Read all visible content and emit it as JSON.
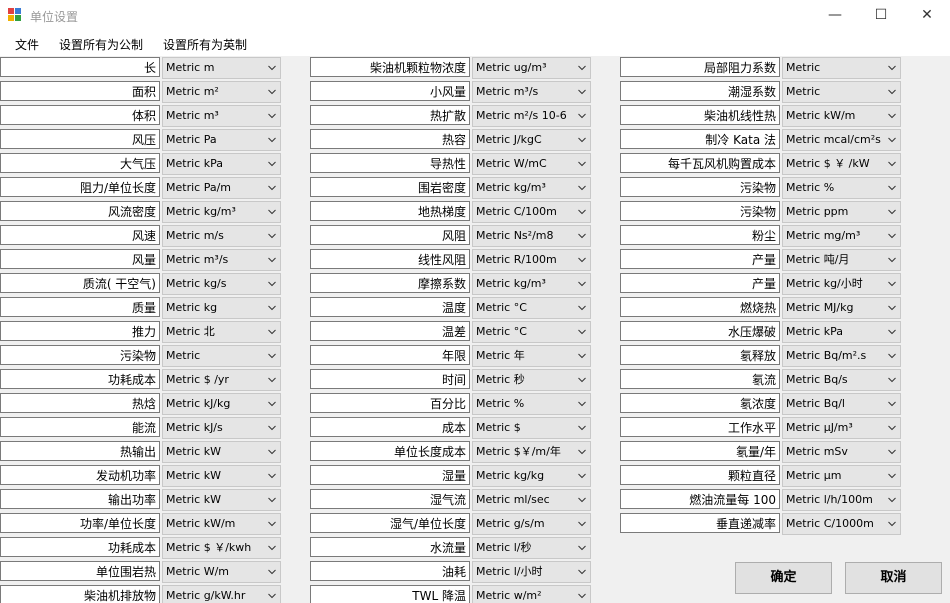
{
  "window": {
    "title": "单位设置"
  },
  "menu": {
    "file": "文件",
    "set_metric": "设置所有为公制",
    "set_imperial": "设置所有为英制"
  },
  "columns": [
    {
      "rows": [
        {
          "label": "长",
          "unit": "Metric m"
        },
        {
          "label": "面积",
          "unit": "Metric m²"
        },
        {
          "label": "体积",
          "unit": "Metric m³"
        },
        {
          "label": "风压",
          "unit": "Metric Pa"
        },
        {
          "label": "大气压",
          "unit": "Metric kPa"
        },
        {
          "label": "阻力/单位长度",
          "unit": "Metric Pa/m"
        },
        {
          "label": "风流密度",
          "unit": "Metric kg/m³"
        },
        {
          "label": "风速",
          "unit": "Metric m/s"
        },
        {
          "label": "风量",
          "unit": "Metric m³/s"
        },
        {
          "label": "质流( 干空气)",
          "unit": "Metric kg/s"
        },
        {
          "label": "质量",
          "unit": "Metric kg"
        },
        {
          "label": "推力",
          "unit": "Metric 北"
        },
        {
          "label": "污染物",
          "unit": "Metric"
        },
        {
          "label": "功耗成本",
          "unit": "Metric $ /yr"
        },
        {
          "label": "热焓",
          "unit": "Metric kJ/kg"
        },
        {
          "label": "能流",
          "unit": "Metric kJ/s"
        },
        {
          "label": "热输出",
          "unit": "Metric kW"
        },
        {
          "label": "发动机功率",
          "unit": "Metric kW"
        },
        {
          "label": "输出功率",
          "unit": "Metric kW"
        },
        {
          "label": "功率/单位长度",
          "unit": "Metric kW/m"
        },
        {
          "label": "功耗成本",
          "unit": "Metric $ ￥/kwh"
        },
        {
          "label": "单位围岩热",
          "unit": "Metric W/m"
        },
        {
          "label": "柴油机排放物",
          "unit": "Metric g/kW.hr"
        }
      ]
    },
    {
      "rows": [
        {
          "label": "柴油机颗粒物浓度",
          "unit": "Metric ug/m³"
        },
        {
          "label": "小风量",
          "unit": "Metric m³/s"
        },
        {
          "label": "热扩散",
          "unit": "Metric m²/s 10-6"
        },
        {
          "label": "热容",
          "unit": "Metric J/kgC"
        },
        {
          "label": "导热性",
          "unit": "Metric W/mC"
        },
        {
          "label": "围岩密度",
          "unit": "Metric kg/m³"
        },
        {
          "label": "地热梯度",
          "unit": "Metric C/100m"
        },
        {
          "label": "风阻",
          "unit": "Metric Ns²/m8"
        },
        {
          "label": "线性风阻",
          "unit": "Metric R/100m"
        },
        {
          "label": "摩擦系数",
          "unit": "Metric kg/m³"
        },
        {
          "label": "温度",
          "unit": "Metric °C"
        },
        {
          "label": "温差",
          "unit": "Metric °C"
        },
        {
          "label": "年限",
          "unit": "Metric 年"
        },
        {
          "label": "时间",
          "unit": "Metric 秒"
        },
        {
          "label": "百分比",
          "unit": "Metric %"
        },
        {
          "label": "成本",
          "unit": "Metric $"
        },
        {
          "label": "单位长度成本",
          "unit": "Metric $￥/m/年"
        },
        {
          "label": "湿量",
          "unit": "Metric kg/kg"
        },
        {
          "label": "湿气流",
          "unit": "Metric ml/sec"
        },
        {
          "label": "湿气/单位长度",
          "unit": "Metric g/s/m"
        },
        {
          "label": "水流量",
          "unit": "Metric l/秒"
        },
        {
          "label": "油耗",
          "unit": "Metric l/小时"
        },
        {
          "label": "TWL 降温",
          "unit": "Metric w/m²"
        }
      ]
    },
    {
      "rows": [
        {
          "label": "局部阻力系数",
          "unit": "Metric"
        },
        {
          "label": "潮湿系数",
          "unit": "Metric"
        },
        {
          "label": "柴油机线性热",
          "unit": "Metric kW/m"
        },
        {
          "label": "制冷 Kata 法",
          "unit": "Metric mcal/cm²s"
        },
        {
          "label": "每千瓦风机购置成本",
          "unit": "Metric $ ￥ /kW"
        },
        {
          "label": "污染物",
          "unit": "Metric %"
        },
        {
          "label": "污染物",
          "unit": "Metric ppm"
        },
        {
          "label": "粉尘",
          "unit": "Metric mg/m³"
        },
        {
          "label": "产量",
          "unit": "Metric 吨/月"
        },
        {
          "label": "产量",
          "unit": "Metric kg/小时"
        },
        {
          "label": "燃烧热",
          "unit": "Metric MJ/kg"
        },
        {
          "label": "水压爆破",
          "unit": "Metric kPa"
        },
        {
          "label": "氡释放",
          "unit": "Metric Bq/m².s"
        },
        {
          "label": "氡流",
          "unit": "Metric Bq/s"
        },
        {
          "label": "氡浓度",
          "unit": "Metric Bq/l"
        },
        {
          "label": "工作水平",
          "unit": "Metric μJ/m³"
        },
        {
          "label": "氡量/年",
          "unit": "Metric mSv"
        },
        {
          "label": "颗粒直径",
          "unit": "Metric μm"
        },
        {
          "label": "燃油流量每   100",
          "unit": "Metric l/h/100m"
        },
        {
          "label": "垂直递减率",
          "unit": "Metric C/1000m"
        }
      ]
    }
  ],
  "buttons": {
    "ok": "确定",
    "cancel": "取消"
  }
}
